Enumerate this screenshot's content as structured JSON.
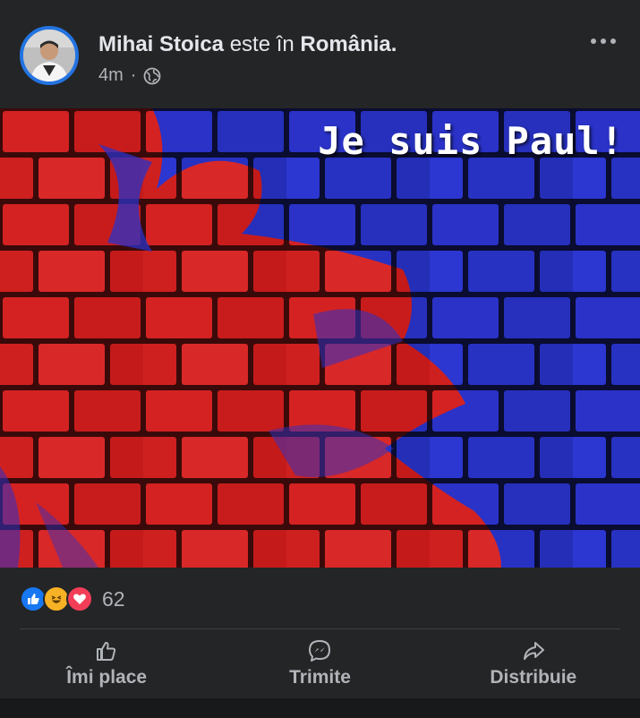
{
  "post": {
    "author_name": "Mihai Stoica",
    "location_prefix": "este în",
    "location_name": "România.",
    "timestamp": "4m",
    "separator": "·",
    "audience_icon": "globe-icon",
    "more_icon": "more-options-icon"
  },
  "image": {
    "caption": "Je suis Paul!",
    "colors": {
      "red": "#d42222",
      "blue": "#2a32c8"
    }
  },
  "reactions": {
    "types": [
      "like-icon",
      "haha-icon",
      "love-icon"
    ],
    "count": "62"
  },
  "actions": [
    {
      "label": "Îmi place",
      "icon": "like-thumb-icon"
    },
    {
      "label": "Trimite",
      "icon": "messenger-icon"
    },
    {
      "label": "Distribuie",
      "icon": "share-icon"
    }
  ],
  "colors": {
    "background": "#242526",
    "text_primary": "#e4e6eb",
    "text_secondary": "#b0b3b8",
    "accent": "#2374e1"
  }
}
